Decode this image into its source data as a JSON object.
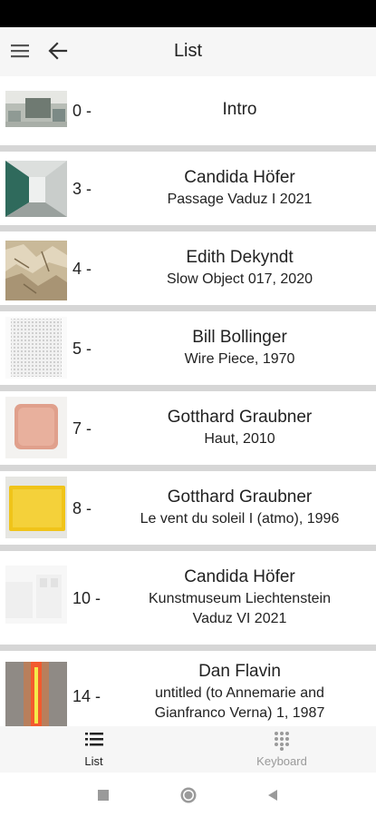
{
  "app": {
    "title": "List",
    "menu_icon": "hamburger-menu-icon",
    "back_icon": "arrow-left-icon"
  },
  "items": [
    {
      "number": "0 -",
      "title": "Intro",
      "thumbnail": "gallery-room-image"
    },
    {
      "number": "3 -",
      "artist": "Candida Höfer",
      "work": "Passage Vaduz I 2021",
      "thumbnail": "corridor-photo-image"
    },
    {
      "number": "4 -",
      "artist": "Edith Dekyndt",
      "work": "Slow Object 017, 2020",
      "thumbnail": "crumpled-foil-image"
    },
    {
      "number": "5 -",
      "artist": "Bill Bollinger",
      "work": "Wire Piece, 1970",
      "thumbnail": "wire-mesh-image"
    },
    {
      "number": "7 -",
      "artist": "Gotthard Graubner",
      "work": "Haut, 2010",
      "thumbnail": "pink-painting-image"
    },
    {
      "number": "8 -",
      "artist": "Gotthard Graubner",
      "work": "Le vent du soleil I (atmo), 1996",
      "thumbnail": "yellow-painting-image"
    },
    {
      "number": "10 -",
      "artist": "Candida Höfer",
      "work": "Kunstmuseum Liechtenstein\nVaduz VI 2021",
      "thumbnail": "white-interior-image"
    },
    {
      "number": "14 -",
      "artist": "Dan Flavin",
      "work": "untitled (to Annemarie and\nGianfranco Verna) 1, 1987",
      "thumbnail": "fluorescent-light-image"
    }
  ],
  "bottom_nav": {
    "list_label": "List",
    "keyboard_label": "Keyboard",
    "active_color": "#222222",
    "inactive_color": "#9a9a9a"
  }
}
